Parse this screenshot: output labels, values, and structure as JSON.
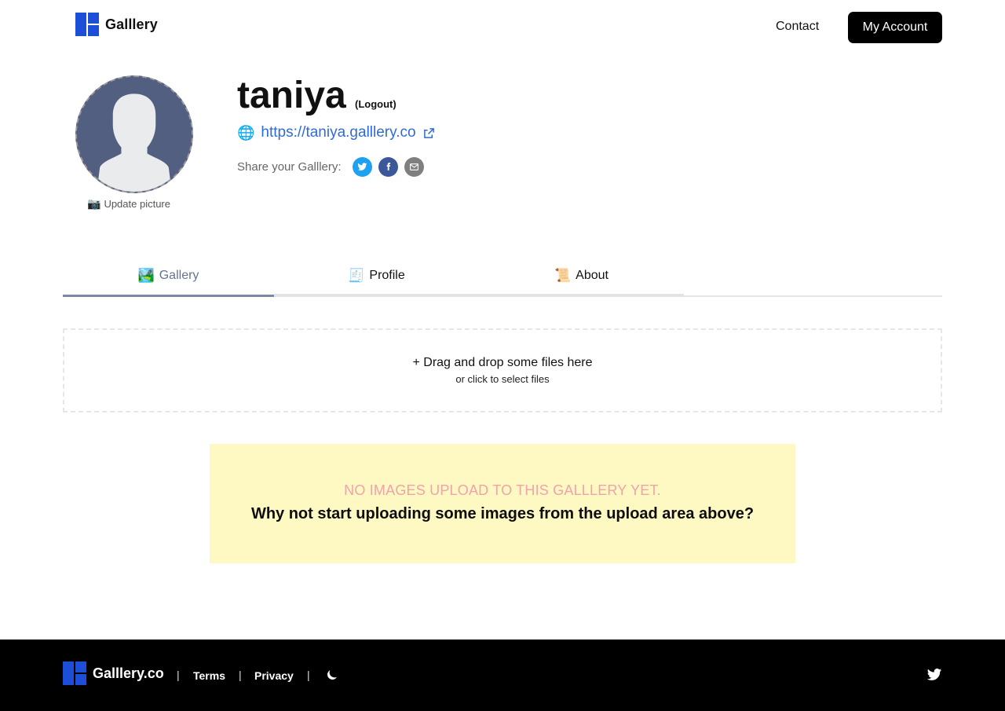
{
  "header": {
    "logo_text": "Galllery",
    "nav": {
      "contact": "Contact",
      "account": "My Account"
    }
  },
  "profile": {
    "username": "taniya",
    "logout": "(Logout)",
    "site_url": "https://taniya.galllery.co",
    "share_label": "Share your Galllery:",
    "update_picture": "Update picture",
    "share_buttons": [
      {
        "name": "twitter-share-icon",
        "color": "#1da1f2"
      },
      {
        "name": "facebook-share-icon",
        "color": "#3b5998"
      },
      {
        "name": "email-share-icon",
        "color": "#7f7f7f"
      }
    ]
  },
  "tabs": [
    {
      "label": "Gallery",
      "icon": "🏞️",
      "active": true
    },
    {
      "label": "Profile",
      "icon": "🧾",
      "active": false
    },
    {
      "label": "About",
      "icon": "📜",
      "active": false
    }
  ],
  "dropzone": {
    "main": "+ Drag and drop some files here",
    "sub": "or click to select files"
  },
  "notice": {
    "title": "NO IMAGES UPLOAD TO THIS GALLLERY YET.",
    "text": "Why not start uploading some images from the upload area above?"
  },
  "footer": {
    "logo_text": "Galllery.co",
    "terms": "Terms",
    "privacy": "Privacy",
    "sep": "|"
  },
  "colors": {
    "brand": "#1d4ed8",
    "notice_bg": "#fef9c3",
    "notice_title": "#f0a3a9",
    "link": "#2f6bd8",
    "active_tab": "#66738f"
  }
}
